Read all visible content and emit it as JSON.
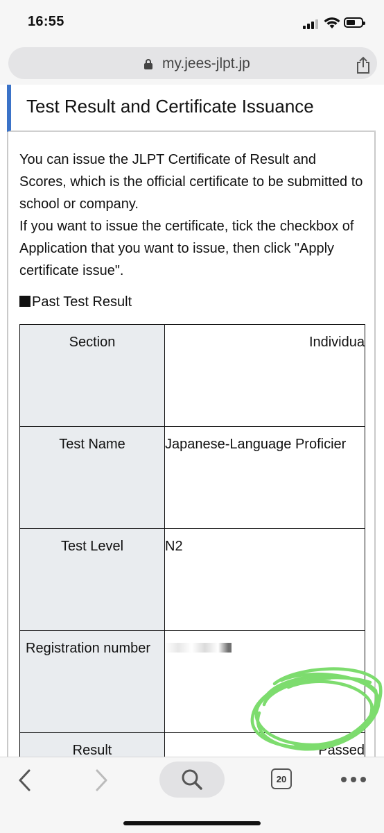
{
  "status_bar": {
    "time": "16:55"
  },
  "browser": {
    "url": "my.jees-jlpt.jp"
  },
  "page": {
    "title": "Test Result and Certificate Issuance",
    "description": [
      "You can issue the JLPT Certificate of Result and Scores, which is the official certificate to be submitted to school or company.",
      "If you want to issue the certificate, tick the checkbox of Application that you want to issue, then click \"Apply certificate issue\"."
    ],
    "section_heading": "Past Test Result",
    "result_table": {
      "rows": [
        {
          "label": "Section",
          "value": "Individua"
        },
        {
          "label": "Test Name",
          "value": "Japanese-Language Proficier"
        },
        {
          "label": "Test Level",
          "value": "N2"
        },
        {
          "label": "Registration number",
          "value": ""
        },
        {
          "label": "Result",
          "value": "Passed"
        }
      ]
    }
  },
  "toolbar": {
    "tab_count": "20"
  },
  "colors": {
    "accent": "#3b73c8",
    "highlight": "#7ddc6e",
    "label_cell": "#e9ecef"
  }
}
